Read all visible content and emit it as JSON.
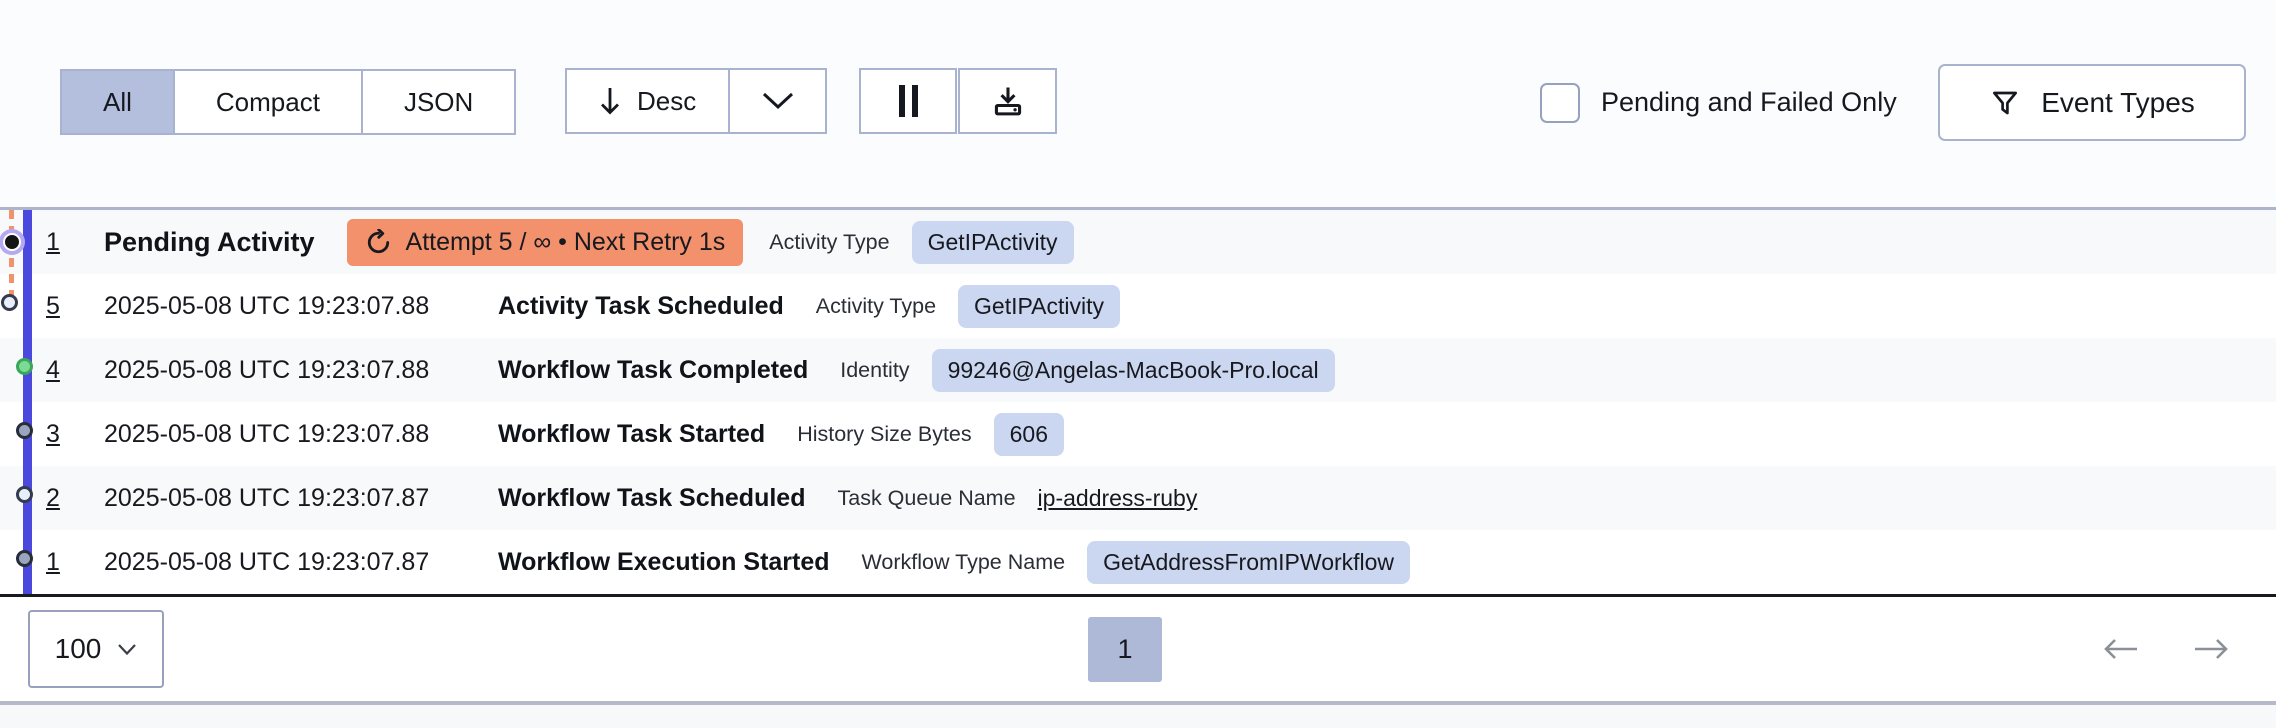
{
  "toolbar": {
    "view_toggle": {
      "options": [
        {
          "label": "All",
          "selected": true
        },
        {
          "label": "Compact",
          "selected": false
        },
        {
          "label": "JSON",
          "selected": false
        }
      ]
    },
    "sort": {
      "label": "Desc"
    },
    "pending_failed_checkbox": {
      "label": "Pending and Failed Only",
      "checked": false
    },
    "event_types_button": {
      "label": "Event Types"
    }
  },
  "events": [
    {
      "id": "1",
      "kind": "pending",
      "name": "Pending Activity",
      "retry_badge": "Attempt 5 / ∞ • Next Retry 1s",
      "attr_label": "Activity Type",
      "attr_value": "GetIPActivity",
      "value_style": "badge",
      "dot": "pending",
      "dot_position": "outer"
    },
    {
      "id": "5",
      "time": "2025-05-08 UTC 19:23:07.88",
      "name": "Activity Task Scheduled",
      "attr_label": "Activity Type",
      "attr_value": "GetIPActivity",
      "value_style": "badge",
      "dot": "light",
      "dot_position": "outer"
    },
    {
      "id": "4",
      "time": "2025-05-08 UTC 19:23:07.88",
      "name": "Workflow Task Completed",
      "attr_label": "Identity",
      "attr_value": "99246@Angelas-MacBook-Pro.local",
      "value_style": "badge",
      "dot": "green",
      "dot_position": "rail"
    },
    {
      "id": "3",
      "time": "2025-05-08 UTC 19:23:07.88",
      "name": "Workflow Task Started",
      "attr_label": "History Size Bytes",
      "attr_value": "606",
      "value_style": "badge",
      "dot": "gray",
      "dot_position": "rail"
    },
    {
      "id": "2",
      "time": "2025-05-08 UTC 19:23:07.87",
      "name": "Workflow Task Scheduled",
      "attr_label": "Task Queue Name",
      "attr_value": "ip-address-ruby",
      "value_style": "link",
      "dot": "light",
      "dot_position": "rail"
    },
    {
      "id": "1",
      "time": "2025-05-08 UTC 19:23:07.87",
      "name": "Workflow Execution Started",
      "attr_label": "Workflow Type Name",
      "attr_value": "GetAddressFromIPWorkflow",
      "value_style": "badge",
      "dot": "gray",
      "dot_position": "rail"
    }
  ],
  "pagination": {
    "page_size": "100",
    "current_page": "1"
  },
  "icons": {
    "sort_direction": "arrow-down",
    "sort_expand": "chevron-down",
    "pause": "pause-bars",
    "download": "download-tray",
    "filter": "funnel",
    "retry": "retry-circular-arrow",
    "page_size_expand": "chevron-down",
    "prev_page": "arrow-left",
    "next_page": "arrow-right"
  },
  "colors": {
    "timeline_rail": "#4b48dd",
    "pending_accent": "#f2916c",
    "value_badge_bg": "#cbd6f0",
    "selected_toggle_bg": "#b4bedd",
    "page_button_bg": "#aeb9d8",
    "green_dot": "#7bdb95",
    "gray_dot": "#9aa6bd",
    "light_dot": "#e9eefb",
    "pending_dot_ring": "#b5aaf0",
    "border": "#a9b3cf"
  }
}
